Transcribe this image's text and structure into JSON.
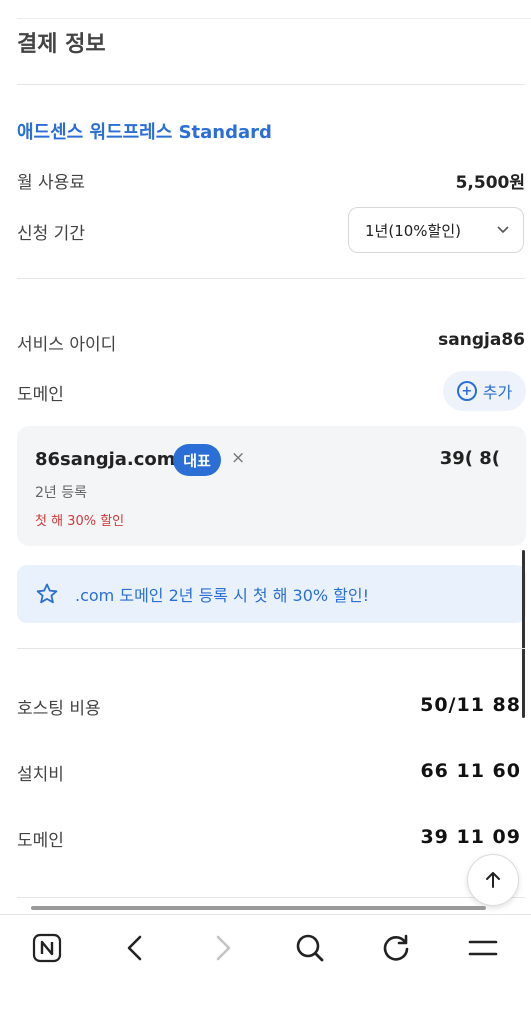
{
  "section": {
    "title": "결제 정보"
  },
  "product": {
    "name": "애드센스 워드프레스 Standard"
  },
  "monthly_fee": {
    "label": "월 사용료",
    "value": "5,500원"
  },
  "period": {
    "label": "신청 기간",
    "selected": "1년(10%할인)"
  },
  "service_id": {
    "label": "서비스 아이디",
    "value": "sangja86"
  },
  "domain": {
    "label": "도메인",
    "add_label": "추가",
    "item": {
      "name": "86sangja.com",
      "badge": "대표",
      "remove": "×",
      "price": "39( 8(",
      "years": "2년 등록",
      "discount": "첫 해 30% 할인"
    }
  },
  "promo": {
    "text": ".com 도메인 2년 등록 시 첫 해 30% 할인!"
  },
  "fees": [
    {
      "label": "호스팅 비용",
      "value": "50/11 88"
    },
    {
      "label": "설치비",
      "value": "66 11 60"
    },
    {
      "label": "도메인",
      "value": "39 11 09"
    }
  ],
  "icons": {
    "add": "plus-circle-icon",
    "promo": "star-icon",
    "scroll_top": "arrow-up-icon",
    "nav": [
      "naver-n-icon",
      "back-icon",
      "forward-icon",
      "search-icon",
      "refresh-icon",
      "menu-icon"
    ]
  },
  "colors": {
    "accent": "#2b6fd6",
    "discount": "#d13b3b",
    "promo_bg": "#e9f1fc",
    "card_bg": "#f4f5f7"
  }
}
